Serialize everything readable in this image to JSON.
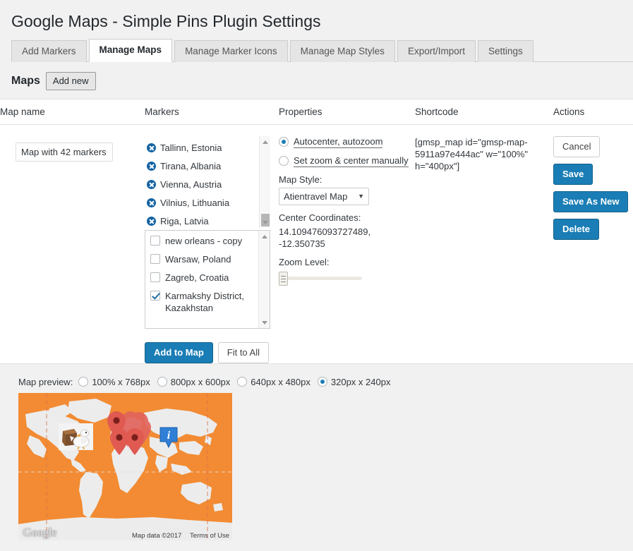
{
  "page": {
    "title": "Google Maps - Simple Pins Plugin Settings"
  },
  "tabs": [
    {
      "label": "Add Markers",
      "active": false
    },
    {
      "label": "Manage Maps",
      "active": true
    },
    {
      "label": "Manage Marker Icons",
      "active": false
    },
    {
      "label": "Manage Map Styles",
      "active": false
    },
    {
      "label": "Export/Import",
      "active": false
    },
    {
      "label": "Settings",
      "active": false
    }
  ],
  "maps_section": {
    "heading": "Maps",
    "add_new_label": "Add new"
  },
  "table": {
    "headers": {
      "map_name": "Map name",
      "markers": "Markers",
      "properties": "Properties",
      "shortcode": "Shortcode",
      "actions": "Actions"
    },
    "row": {
      "map_name_value": "Map with 42 markers",
      "assigned_markers": [
        "Tallinn, Estonia",
        "Tirana, Albania",
        "Vienna, Austria",
        "Vilnius, Lithuania",
        "Riga, Latvia"
      ],
      "available_markers": [
        {
          "label": "new orleans - copy",
          "checked": false
        },
        {
          "label": "Warsaw, Poland",
          "checked": false
        },
        {
          "label": "Zagreb, Croatia",
          "checked": false
        },
        {
          "label": "Karmakshy District, Kazakhstan",
          "checked": true
        }
      ],
      "marker_buttons": {
        "add_to_map": "Add to Map",
        "fit_to_all": "Fit to All"
      },
      "properties": {
        "radio_autocenter": "Autocenter, autozoom",
        "radio_manual": "Set zoom & center manually",
        "selected_radio": "autocenter",
        "map_style_label": "Map Style:",
        "map_style_value": "Atientravel Map",
        "center_coordinates_label": "Center Coordinates:",
        "center_coordinates_value": "14.109476093727489, -12.350735",
        "zoom_level_label": "Zoom Level:",
        "zoom_level_value": 0
      },
      "shortcode": "[gmsp_map id=\"gmsp-map-5911a97e444ac\" w=\"100%\" h=\"400px\"]",
      "actions": {
        "cancel": "Cancel",
        "save": "Save",
        "save_as_new": "Save As New",
        "delete": "Delete"
      }
    }
  },
  "preview": {
    "label": "Map preview:",
    "sizes": [
      {
        "label": "100% x 768px",
        "selected": false
      },
      {
        "label": "800px x 600px",
        "selected": false
      },
      {
        "label": "640px x 480px",
        "selected": false
      },
      {
        "label": "320px x 240px",
        "selected": true
      }
    ],
    "watermark": "Google",
    "map_data": "Map data ©2017",
    "terms": "Terms of Use"
  },
  "colors": {
    "accent_blue": "#1a7db5",
    "map_orange": "#f28b33",
    "map_land": "#ececec",
    "pin_red": "#e05a52",
    "info_blue": "#2f7fd6"
  }
}
